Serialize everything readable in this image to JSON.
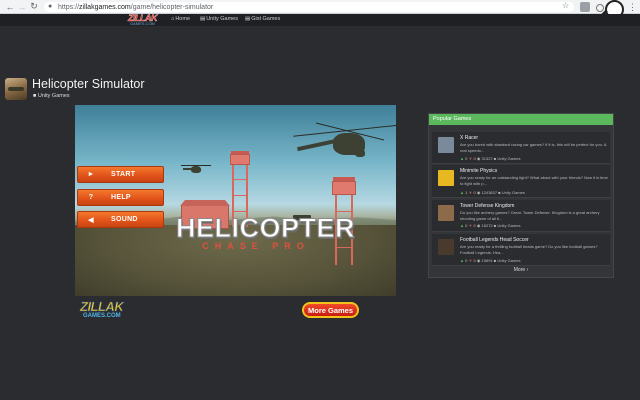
{
  "browser": {
    "url_scheme": "https://",
    "url_domain": "zillakgames.com",
    "url_path": "/game/helicopter-simulator",
    "back_icon": "back-arrow-icon",
    "forward_icon": "forward-arrow-icon"
  },
  "site": {
    "logo_text": "ZILLAK",
    "logo_subtext": "GAMES.COM",
    "nav": [
      {
        "label": "Home",
        "icon": "home-icon"
      },
      {
        "label": "Unity Games",
        "icon": "gamepad-icon"
      },
      {
        "label": "Gist Games",
        "icon": "gamepad-icon"
      }
    ]
  },
  "game": {
    "title": "Helicopter Simulator",
    "category": "Unity Games",
    "logo_line1": "HELICOPTER",
    "logo_line2": "CHASE PRO",
    "menu": [
      {
        "label": "START",
        "icon": "play-icon"
      },
      {
        "label": "HELP",
        "icon": "question-icon"
      },
      {
        "label": "SOUND",
        "icon": "speaker-icon"
      }
    ],
    "footer_logo": "ZILLAK",
    "footer_logo_sub": "GAMES.COM",
    "more_games": "More Games"
  },
  "popular": {
    "heading": "Popular Games",
    "more_label": "More",
    "items": [
      {
        "title": "X Racer",
        "desc": "Are you bored with standard racing car games? If it is, this will be perfect for you. A real speedo...",
        "up": "0",
        "down": "0",
        "views": "31327",
        "category": "Unity Games",
        "thumb_color": "#7a8a9a"
      },
      {
        "title": "Minimite Physics",
        "desc": "Are you ready for an outstanding fight? What about with your friends? Now it is time to fight with p...",
        "up": "1",
        "down": "0",
        "views": "1243837",
        "category": "Unity Games",
        "thumb_color": "#e8b820"
      },
      {
        "title": "Tower Defense Kingdom",
        "desc": "Do you like archery games? Great. Tower Defense: Kingdom is a great archery shooting game of all ti...",
        "up": "0",
        "down": "0",
        "views": "16272",
        "category": "Unity Games",
        "thumb_color": "#8b6b4a"
      },
      {
        "title": "Football Legends Head Soccer",
        "desc": "Are you ready for a thrilling football heads game? Do you like football games? Football Legends: Hea...",
        "up": "0",
        "down": "0",
        "views": "15691",
        "category": "Unity Games",
        "thumb_color": "#4a3a2e"
      }
    ]
  }
}
